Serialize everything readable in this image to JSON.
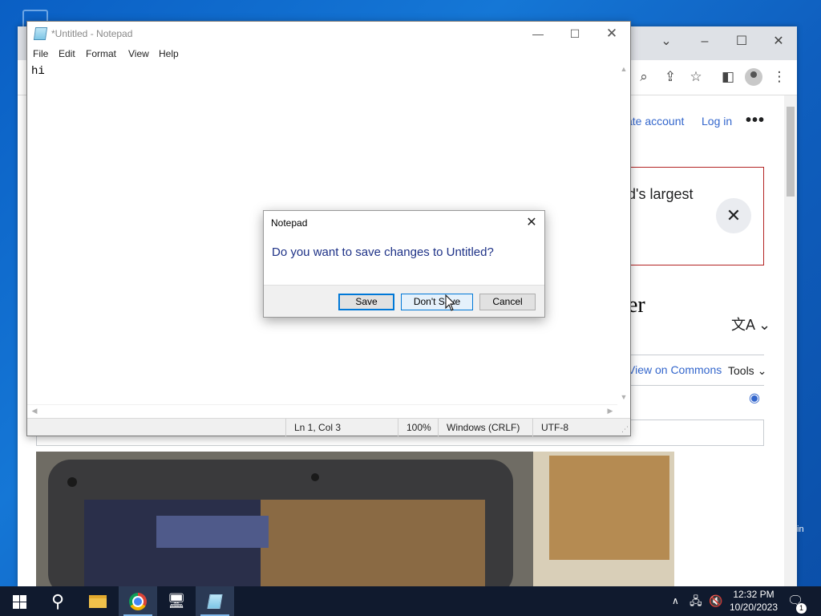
{
  "desktop": {
    "right_edge_text": "in"
  },
  "browser": {
    "wiki": {
      "create_account": "ate account",
      "login": "Log in",
      "more_menu": "•••",
      "banner_text": "d's largest",
      "banner_close": "✕",
      "heading_fragment": "er",
      "view_on_commons": "View on Commons",
      "tools": "Tools"
    }
  },
  "notepad": {
    "title": "*Untitled - Notepad",
    "menu": [
      "File",
      "Edit",
      "Format",
      "View",
      "Help"
    ],
    "content": "hi",
    "status": {
      "position": "Ln 1, Col 3",
      "zoom": "100%",
      "line_ending": "Windows (CRLF)",
      "encoding": "UTF-8"
    }
  },
  "dialog": {
    "title": "Notepad",
    "message": "Do you want to save changes to Untitled?",
    "buttons": {
      "save": "Save",
      "dont_save": "Don't Save",
      "cancel": "Cancel"
    }
  },
  "taskbar": {
    "clock_time": "12:32 PM",
    "clock_date": "10/20/2023",
    "notification_count": "1"
  }
}
